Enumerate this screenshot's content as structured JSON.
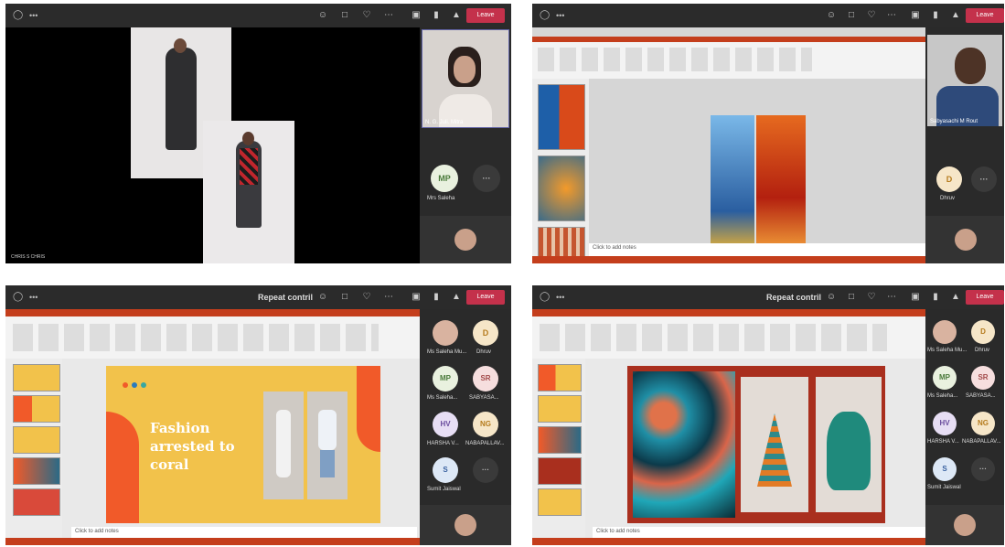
{
  "panels": {
    "p1": {
      "caption": "CHRIS S CHRIS",
      "rail": {
        "video_caption": "N. G. Juli. Mitra",
        "avatars": [
          {
            "initials": "MP",
            "name": "Mrs Saleha",
            "bg": "#e9f1df",
            "fg": "#4a7a3a"
          },
          {
            "initials": "···",
            "name": "",
            "bg": "#3a3a3a",
            "fg": "#bbb"
          }
        ]
      }
    },
    "p2": {
      "notes_text": "Click to add notes",
      "rail": {
        "video_caption": "Sabyasachi M Rout",
        "avatars": [
          {
            "initials": "D",
            "name": "Dhruv",
            "bg": "#f6e6c8",
            "fg": "#b57b1d"
          },
          {
            "initials": "···",
            "name": "",
            "bg": "#3a3a3a",
            "fg": "#bbb"
          }
        ]
      }
    },
    "p3": {
      "title": "Repeat contril",
      "slide_title": "Fashion arrested to coral",
      "notes_text": "Click to add notes",
      "rail": {
        "avatars": [
          {
            "initials": "",
            "name": "Ms Saleha Mu...",
            "bg": "#d9b3a0",
            "fg": "#fff",
            "photo": true
          },
          {
            "initials": "D",
            "name": "Dhruv",
            "bg": "#f6e6c8",
            "fg": "#b57b1d"
          },
          {
            "initials": "MP",
            "name": "Ms Saleha...",
            "bg": "#e9f1df",
            "fg": "#4a7a3a"
          },
          {
            "initials": "SR",
            "name": "SABYASA...",
            "bg": "#f6dede",
            "fg": "#a34a4a"
          },
          {
            "initials": "HV",
            "name": "HARSHA V...",
            "bg": "#e7def4",
            "fg": "#6b4d9e"
          },
          {
            "initials": "NG",
            "name": "NABAPALLAV...",
            "bg": "#f6e6c8",
            "fg": "#b57b1d"
          },
          {
            "initials": "S",
            "name": "Sumit Jaiswal",
            "bg": "#dde8f6",
            "fg": "#3a62a0"
          },
          {
            "initials": "···",
            "name": "",
            "bg": "#3a3a3a",
            "fg": "#bbb"
          }
        ]
      }
    },
    "p4": {
      "title": "Repeat contril",
      "notes_text": "Click to add notes",
      "rail": {
        "avatars": [
          {
            "initials": "",
            "name": "Ms Saleha Mu...",
            "bg": "#d9b3a0",
            "fg": "#fff",
            "photo": true
          },
          {
            "initials": "D",
            "name": "Dhruv",
            "bg": "#f6e6c8",
            "fg": "#b57b1d"
          },
          {
            "initials": "MP",
            "name": "Ms Saleha...",
            "bg": "#e9f1df",
            "fg": "#4a7a3a"
          },
          {
            "initials": "SR",
            "name": "SABYASA...",
            "bg": "#f6dede",
            "fg": "#a34a4a"
          },
          {
            "initials": "HV",
            "name": "HARSHA V...",
            "bg": "#e7def4",
            "fg": "#6b4d9e"
          },
          {
            "initials": "NG",
            "name": "NABAPALLAV...",
            "bg": "#f6e6c8",
            "fg": "#b57b1d"
          },
          {
            "initials": "S",
            "name": "Sumit Jaiswal",
            "bg": "#dde8f6",
            "fg": "#3a62a0"
          },
          {
            "initials": "···",
            "name": "",
            "bg": "#3a3a3a",
            "fg": "#bbb"
          }
        ]
      }
    }
  },
  "leave_label": "Leave",
  "colors": {
    "teams_bg": "#1f1f1f",
    "leave_red": "#c4314b",
    "ppt_red": "#c43e1c",
    "slide_yellow": "#f2c24b",
    "slide_orange": "#f15a29"
  }
}
